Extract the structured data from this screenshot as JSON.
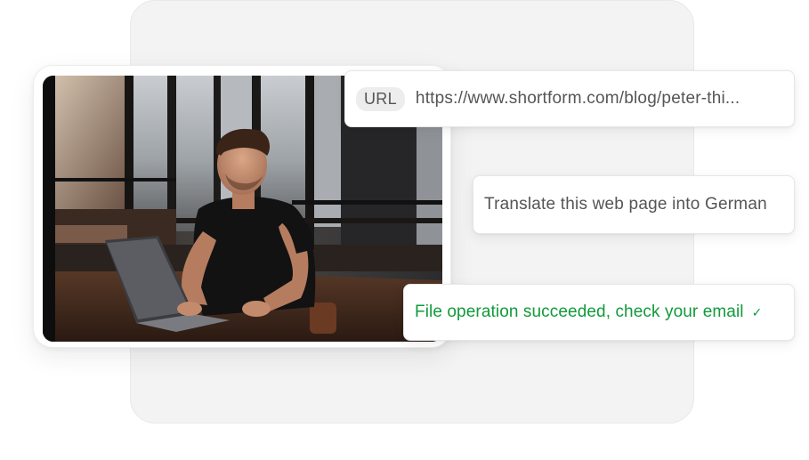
{
  "url_chip": {
    "badge": "URL",
    "value": "https://www.shortform.com/blog/peter-thi..."
  },
  "prompt_chip": {
    "text": "Translate this web page into German"
  },
  "status_chip": {
    "text": "File operation succeeded, check your email",
    "icon": "checkmark-icon",
    "icon_glyph": "✓",
    "color": "#119a3a"
  },
  "photo": {
    "subject": "photo-man-working-on-laptop"
  },
  "colors": {
    "backdrop": "#f3f3f3",
    "chip_text": "#555555",
    "badge_bg": "#ededed",
    "success": "#119a3a"
  }
}
